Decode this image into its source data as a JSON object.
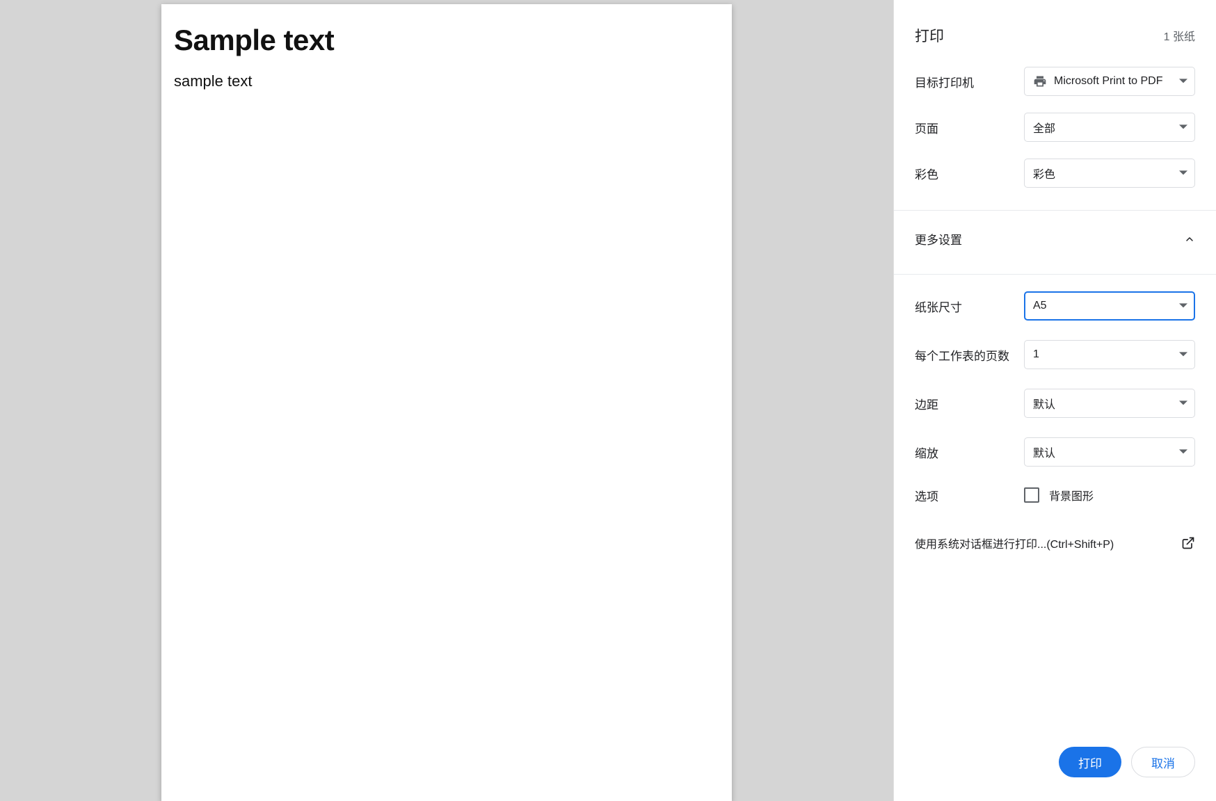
{
  "preview": {
    "heading": "Sample text",
    "body": "sample text"
  },
  "panel": {
    "title": "打印",
    "sheet_count": "1 张纸",
    "destination_label": "目标打印机",
    "destination_value": "Microsoft Print to PDF",
    "pages_label": "页面",
    "pages_value": "全部",
    "color_label": "彩色",
    "color_value": "彩色",
    "more_settings_label": "更多设置",
    "paper_size_label": "纸张尺寸",
    "paper_size_value": "A5",
    "pages_per_sheet_label": "每个工作表的页数",
    "pages_per_sheet_value": "1",
    "margins_label": "边距",
    "margins_value": "默认",
    "scale_label": "缩放",
    "scale_value": "默认",
    "options_label": "选项",
    "background_graphics_label": "背景图形",
    "system_dialog_text": "使用系统对话框进行打印...(Ctrl+Shift+P)",
    "print_button": "打印",
    "cancel_button": "取消"
  }
}
